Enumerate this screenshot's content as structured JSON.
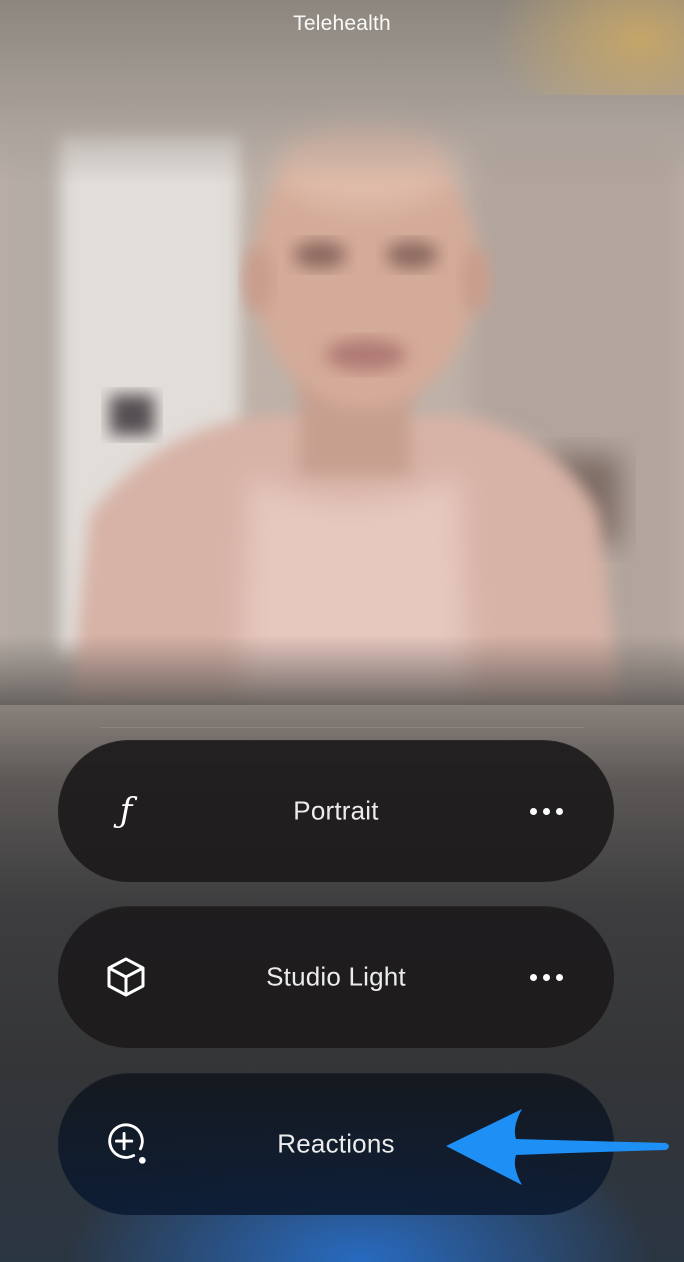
{
  "app": {
    "title": "Telehealth"
  },
  "effects": [
    {
      "label": "Portrait",
      "icon": "f-stop-icon",
      "has_more": true
    },
    {
      "label": "Studio Light",
      "icon": "cube-icon",
      "has_more": true
    },
    {
      "label": "Reactions",
      "icon": "reactions-icon",
      "has_more": false
    }
  ],
  "annotation": {
    "icon": "arrow-left-icon",
    "color": "#1e8ff5",
    "points_to": "Reactions"
  }
}
